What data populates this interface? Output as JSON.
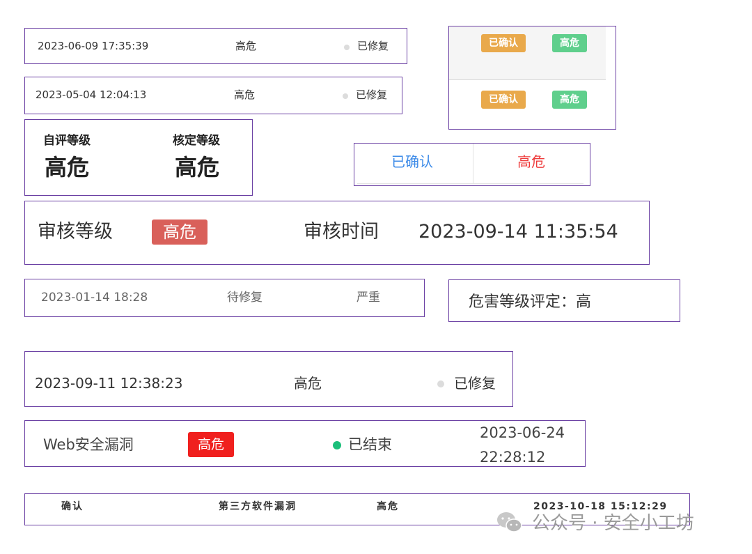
{
  "card1": {
    "time": "2023-06-09 17:35:39",
    "level": "高危",
    "status": "已修复"
  },
  "card2": {
    "time": "2023-05-04 12:04:13",
    "level": "高危",
    "status": "已修复"
  },
  "card3": {
    "self_label": "自评等级",
    "self_value": "高危",
    "verify_label": "核定等级",
    "verify_value": "高危"
  },
  "card4": {
    "rows": [
      {
        "status": "已确认",
        "level": "高危"
      },
      {
        "status": "已确认",
        "level": "高危"
      }
    ]
  },
  "card5": {
    "status": "已确认",
    "level": "高危"
  },
  "card6": {
    "level_label": "审核等级",
    "level": "高危",
    "time_label": "审核时间",
    "time": "2023-09-14 11:35:54"
  },
  "card7": {
    "time": "2023-01-14 18:28",
    "status": "待修复",
    "level": "严重"
  },
  "card8": {
    "text": "危害等级评定：高"
  },
  "card9": {
    "time": "2023-09-11 12:38:23",
    "level": "高危",
    "status": "已修复"
  },
  "card10": {
    "type": "Web安全漏洞",
    "level": "高危",
    "status": "已结束",
    "date": "2023-06-24",
    "time": "22:28:12"
  },
  "card11": {
    "status": "确认",
    "type": "第三方软件漏洞",
    "level": "高危",
    "time": "2023-10-18 15:12:29"
  },
  "watermark": {
    "text": "公众号 · 安全小工坊"
  },
  "colors": {
    "border": "#6a3fa3",
    "orange_tag": "#e9a94b",
    "green_tag": "#5fcf8c",
    "blue_text": "#3d8be8",
    "red_text": "#ee3b3b",
    "salmon_tag": "#d9605a",
    "red_tag": "#f0201e",
    "green_dot": "#1bbf7a",
    "gray_dot": "#dcdcdc"
  }
}
